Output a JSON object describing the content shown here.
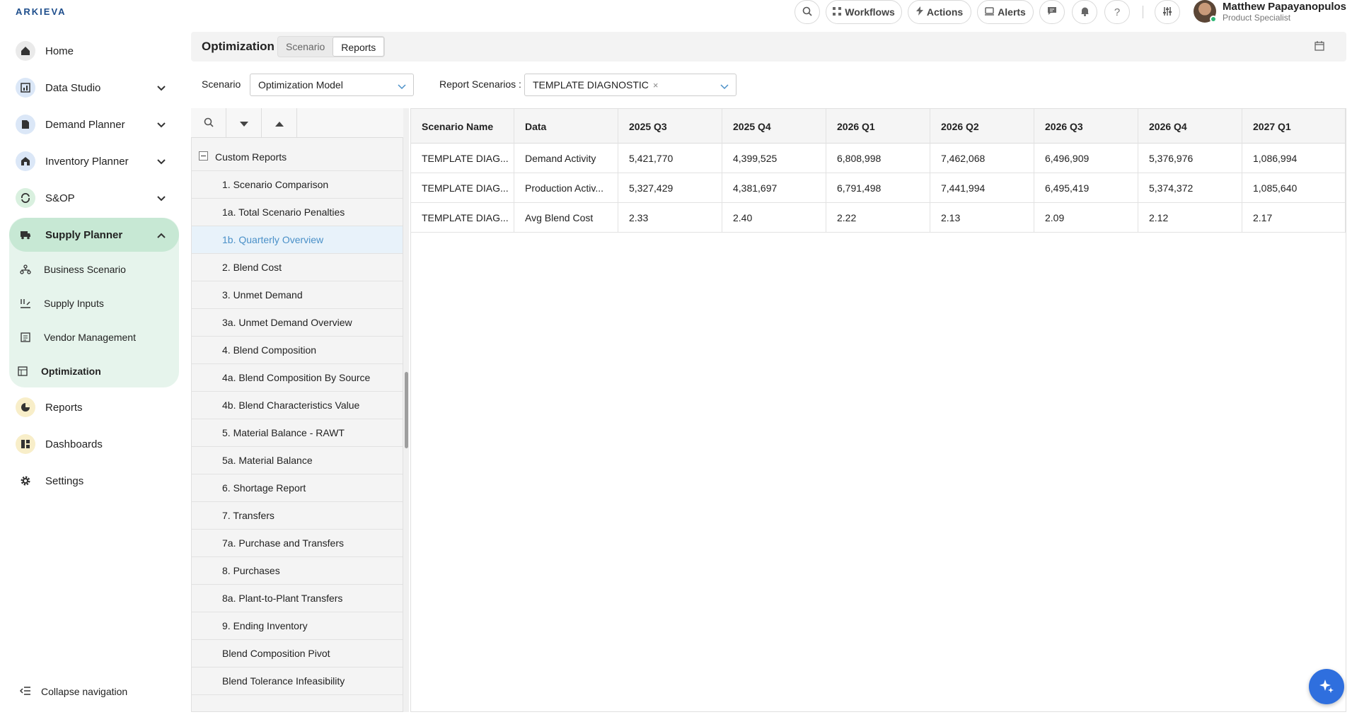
{
  "app": {
    "logo": "ARKIEVA"
  },
  "topbar": {
    "workflows": "Workflows",
    "actions": "Actions",
    "alerts": "Alerts",
    "user_name": "Matthew Papayanopulos",
    "user_role": "Product Specialist"
  },
  "sidebar": {
    "items": [
      {
        "label": "Home",
        "icon": "home-icon"
      },
      {
        "label": "Data Studio",
        "icon": "data-studio-icon"
      },
      {
        "label": "Demand Planner",
        "icon": "demand-planner-icon"
      },
      {
        "label": "Inventory Planner",
        "icon": "inventory-planner-icon"
      },
      {
        "label": "S&OP",
        "icon": "sop-icon"
      },
      {
        "label": "Supply Planner",
        "icon": "supply-planner-icon"
      },
      {
        "label": "Reports",
        "icon": "reports-icon"
      },
      {
        "label": "Dashboards",
        "icon": "dashboards-icon"
      },
      {
        "label": "Settings",
        "icon": "settings-icon"
      }
    ],
    "supply_sub": [
      {
        "label": "Business Scenario",
        "icon": "business-scenario-icon"
      },
      {
        "label": "Supply Inputs",
        "icon": "supply-inputs-icon"
      },
      {
        "label": "Vendor Management",
        "icon": "vendor-management-icon"
      },
      {
        "label": "Optimization",
        "icon": "optimization-icon"
      }
    ],
    "collapse_label": "Collapse navigation",
    "accent": "#c7e8d4"
  },
  "header": {
    "title": "Optimization",
    "tabs": [
      "Scenario",
      "Reports"
    ],
    "active_tab": "Reports"
  },
  "filters": {
    "scenario_label": "Scenario",
    "scenario_value": "Optimization Model",
    "report_label": "Report Scenarios :",
    "report_chip": "TEMPLATE DIAGNOSTIC"
  },
  "report_list": {
    "group": "Custom Reports",
    "items": [
      "1. Scenario Comparison",
      "1a. Total Scenario Penalties",
      "1b. Quarterly Overview",
      "2. Blend Cost",
      "3. Unmet Demand",
      "3a. Unmet Demand Overview",
      "4. Blend Composition",
      "4a. Blend Composition By Source",
      "4b. Blend Characteristics Value",
      "5. Material Balance - RAWT",
      "5a. Material Balance",
      "6. Shortage Report",
      "7. Transfers",
      "7a. Purchase and Transfers",
      "8. Purchases",
      "8a. Plant-to-Plant Transfers",
      "9. Ending Inventory",
      "Blend Composition Pivot",
      "Blend Tolerance Infeasibility"
    ],
    "selected": "1b. Quarterly Overview"
  },
  "grid": {
    "columns": [
      "Scenario Name",
      "Data",
      "2025 Q3",
      "2025 Q4",
      "2026 Q1",
      "2026 Q2",
      "2026 Q3",
      "2026 Q4",
      "2027 Q1"
    ],
    "rows": [
      [
        "TEMPLATE DIAG...",
        "Demand Activity",
        "5,421,770",
        "4,399,525",
        "6,808,998",
        "7,462,068",
        "6,496,909",
        "5,376,976",
        "1,086,994"
      ],
      [
        "TEMPLATE DIAG...",
        "Production Activ...",
        "5,327,429",
        "4,381,697",
        "6,791,498",
        "7,441,994",
        "6,495,419",
        "5,374,372",
        "1,085,640"
      ],
      [
        "TEMPLATE DIAG...",
        "Avg Blend Cost",
        "2.33",
        "2.40",
        "2.22",
        "2.13",
        "2.09",
        "2.12",
        "2.17"
      ]
    ]
  }
}
